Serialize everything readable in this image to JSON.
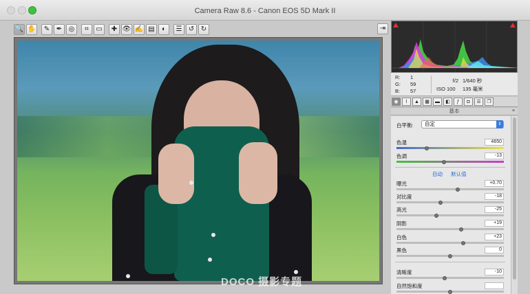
{
  "window": {
    "title": "Camera Raw 8.6 -  Canon EOS 5D Mark II"
  },
  "toolbar": {
    "tools": [
      {
        "icon": "zoom-icon",
        "glyph": "🔍"
      },
      {
        "icon": "hand-icon",
        "glyph": "✋"
      },
      {
        "icon": "white-balance-icon",
        "glyph": "✎"
      },
      {
        "icon": "color-sampler-icon",
        "glyph": "✒"
      },
      {
        "icon": "targeted-adjustment-icon",
        "glyph": "◎"
      },
      {
        "icon": "crop-icon",
        "glyph": "⌗"
      },
      {
        "icon": "straighten-icon",
        "glyph": "▭"
      },
      {
        "icon": "spot-removal-icon",
        "glyph": "✚"
      },
      {
        "icon": "red-eye-icon",
        "glyph": "👁"
      },
      {
        "icon": "adjustment-brush-icon",
        "glyph": "✍"
      },
      {
        "icon": "graduated-filter-icon",
        "glyph": "▤"
      },
      {
        "icon": "radial-filter-icon",
        "glyph": "◐"
      },
      {
        "icon": "preferences-icon",
        "glyph": "☰"
      },
      {
        "icon": "rotate-left-icon",
        "glyph": "↺"
      },
      {
        "icon": "rotate-right-icon",
        "glyph": "↻"
      }
    ],
    "export_icon": "open-export-icon"
  },
  "image": {
    "watermark": "DOCO 摄影专题"
  },
  "info": {
    "r_label": "R:",
    "r_value": "1",
    "g_label": "G:",
    "g_value": "59",
    "b_label": "B:",
    "b_value": "57",
    "aperture": "f/2",
    "shutter": "1/640 秒",
    "iso": "ISO 100",
    "focal": "135 毫米"
  },
  "panel": {
    "header": "基本",
    "white_balance_label": "白平衡:",
    "white_balance_value": "自定",
    "auto_label": "自动",
    "default_label": "默认值",
    "sliders": [
      {
        "label": "色温",
        "value": "4650",
        "pos": 0.28
      },
      {
        "label": "色调",
        "value": "-13",
        "pos": 0.44
      },
      {
        "label": "曝光",
        "value": "+0.70",
        "pos": 0.57
      },
      {
        "label": "对比度",
        "value": "-18",
        "pos": 0.41
      },
      {
        "label": "高光",
        "value": "-25",
        "pos": 0.37
      },
      {
        "label": "阴影",
        "value": "+19",
        "pos": 0.6
      },
      {
        "label": "白色",
        "value": "+23",
        "pos": 0.62
      },
      {
        "label": "黑色",
        "value": "0",
        "pos": 0.5
      },
      {
        "label": "清晰度",
        "value": "-10",
        "pos": 0.45
      },
      {
        "label": "自然饱和度",
        "value": "",
        "pos": 0.5
      }
    ]
  }
}
